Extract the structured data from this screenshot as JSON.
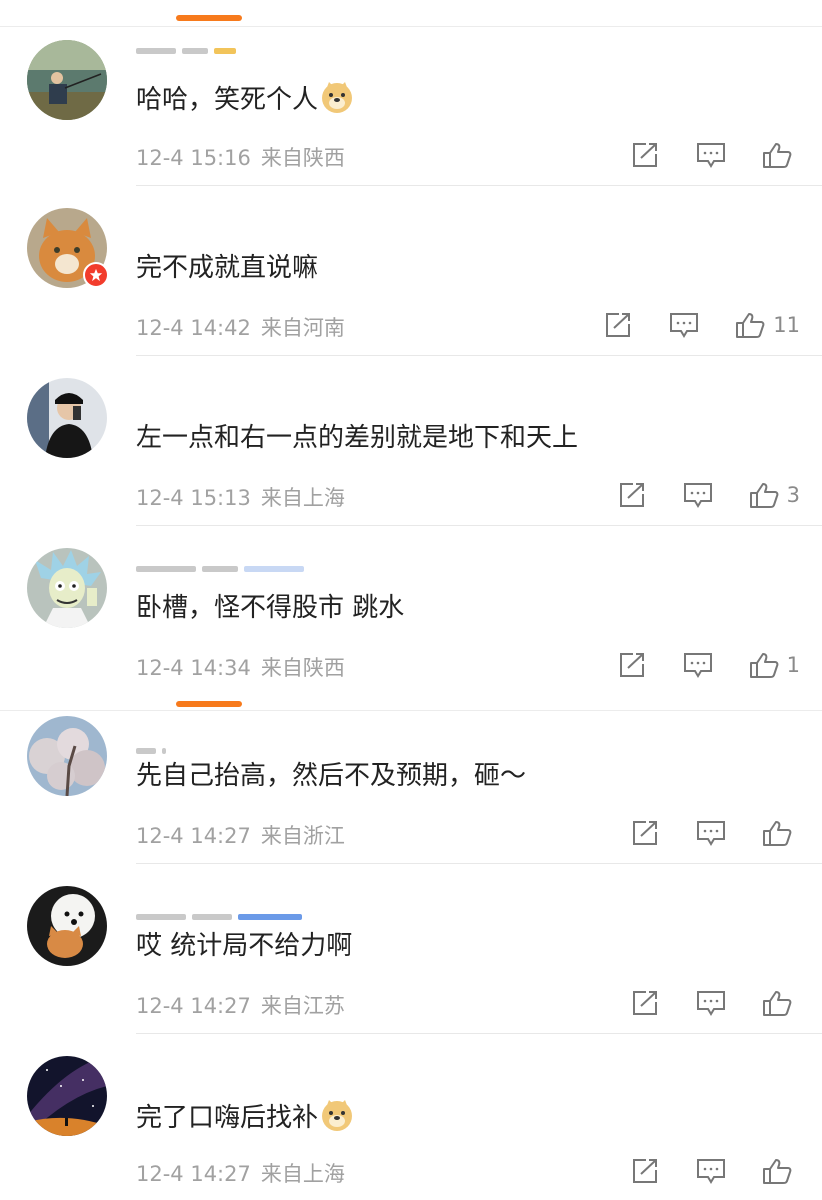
{
  "colors": {
    "accent": "#f77a1c",
    "meta": "#a1a1a1",
    "text": "#222222"
  },
  "comments": [
    {
      "text": "哈哈，笑死个人",
      "emoji": "doge-emoji",
      "time": "12-4 15:16",
      "location": "来自陕西",
      "likes": "",
      "avatar": "fishing-man-avatar"
    },
    {
      "text": "完不成就直说嘛",
      "emoji": "",
      "time": "12-4 14:42",
      "location": "来自河南",
      "likes": "11",
      "avatar": "orange-cat-avatar"
    },
    {
      "text": "左一点和右一点的差别就是地下和天上",
      "emoji": "",
      "time": "12-4 15:13",
      "location": "来自上海",
      "likes": "3",
      "avatar": "man-with-phone-avatar"
    },
    {
      "text": "卧槽，怪不得股市 跳水",
      "emoji": "",
      "time": "12-4 14:34",
      "location": "来自陕西",
      "likes": "1",
      "avatar": "cartoon-scientist-avatar"
    },
    {
      "text": "先自己抬高，然后不及预期，砸～",
      "emoji": "",
      "time": "12-4 14:27",
      "location": "来自浙江",
      "likes": "",
      "avatar": "blossom-tree-avatar"
    },
    {
      "text": "哎 统计局不给力啊",
      "emoji": "",
      "time": "12-4 14:27",
      "location": "来自江苏",
      "likes": "",
      "avatar": "white-dog-and-cat-avatar"
    },
    {
      "text": "完了口嗨后找补",
      "emoji": "doge-emoji",
      "time": "12-4 14:27",
      "location": "来自上海",
      "likes": "",
      "avatar": "starry-sky-avatar"
    }
  ],
  "icons": {
    "share": "share-icon",
    "comment": "comment-icon",
    "like": "thumbs-up-icon"
  }
}
